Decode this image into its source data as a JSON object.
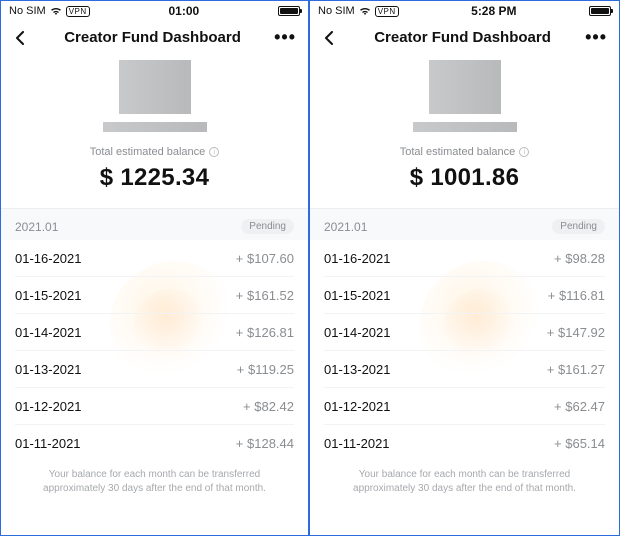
{
  "screens": [
    {
      "status": {
        "carrier": "No SIM",
        "vpn": "VPN",
        "time": "01:00"
      },
      "nav": {
        "title": "Creator Fund Dashboard"
      },
      "balance": {
        "label": "Total estimated balance",
        "amount": "$ 1225.34"
      },
      "section": {
        "month": "2021.01",
        "status": "Pending"
      },
      "transactions": [
        {
          "date": "01-16-2021",
          "amount": "+ $107.60"
        },
        {
          "date": "01-15-2021",
          "amount": "+ $161.52"
        },
        {
          "date": "01-14-2021",
          "amount": "+ $126.81"
        },
        {
          "date": "01-13-2021",
          "amount": "+ $119.25"
        },
        {
          "date": "01-12-2021",
          "amount": "+ $82.42"
        },
        {
          "date": "01-11-2021",
          "amount": "+ $128.44"
        }
      ],
      "footnote": "Your balance for each month can be transferred approximately 30 days after the end of that month."
    },
    {
      "status": {
        "carrier": "No SIM",
        "vpn": "VPN",
        "time": "5:28 PM"
      },
      "nav": {
        "title": "Creator Fund Dashboard"
      },
      "balance": {
        "label": "Total estimated balance",
        "amount": "$ 1001.86"
      },
      "section": {
        "month": "2021.01",
        "status": "Pending"
      },
      "transactions": [
        {
          "date": "01-16-2021",
          "amount": "+ $98.28"
        },
        {
          "date": "01-15-2021",
          "amount": "+ $116.81"
        },
        {
          "date": "01-14-2021",
          "amount": "+ $147.92"
        },
        {
          "date": "01-13-2021",
          "amount": "+ $161.27"
        },
        {
          "date": "01-12-2021",
          "amount": "+ $62.47"
        },
        {
          "date": "01-11-2021",
          "amount": "+ $65.14"
        }
      ],
      "footnote": "Your balance for each month can be transferred approximately 30 days after the end of that month."
    }
  ]
}
